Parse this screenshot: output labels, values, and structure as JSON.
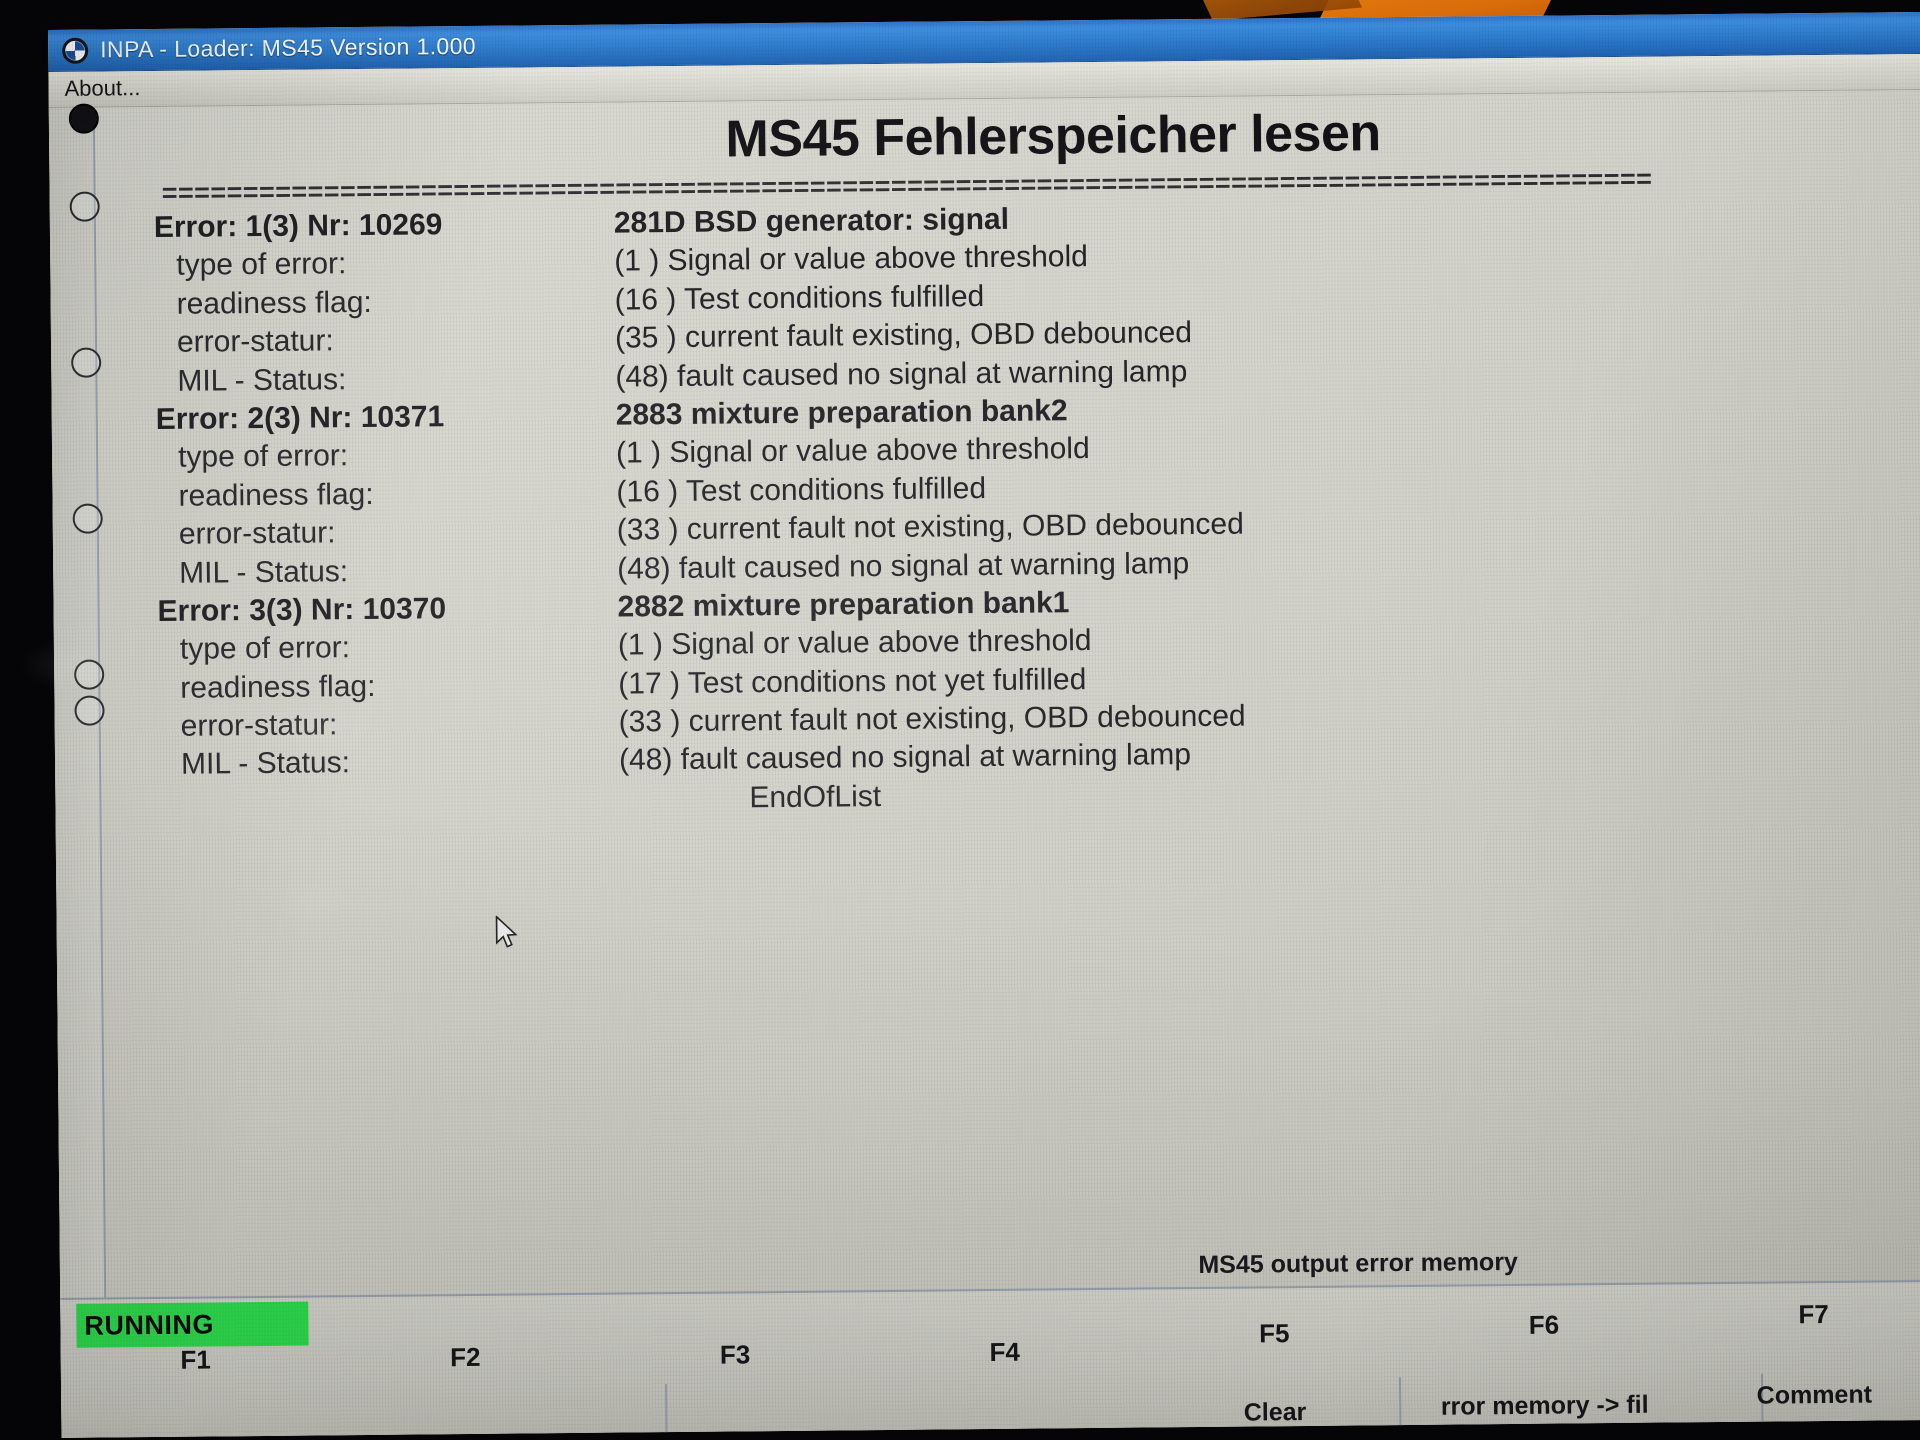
{
  "window": {
    "title": "INPA - Loader:  MS45 Version 1.000",
    "icon": "bmw-roundel-icon"
  },
  "menu": {
    "items": [
      {
        "label": "About..."
      }
    ]
  },
  "page": {
    "heading": "MS45 Fehlerspeicher lesen",
    "separator": "============================================================================================",
    "end_of_list": "EndOfList"
  },
  "labels": {
    "type_of_error": "type of error:",
    "readiness_flag": "readiness flag:",
    "error_statur": "error-statur:",
    "mil_status": "MIL - Status:"
  },
  "errors": [
    {
      "header_label": "Error: 1(3) Nr: 10269",
      "header_value": "281D BSD generator: signal",
      "type_of_error": "(1 ) Signal or value above threshold",
      "readiness_flag": "(16 ) Test conditions fulfilled",
      "error_statur": "(35 ) current fault existing, OBD debounced",
      "mil_status": "(48) fault caused no signal at warning lamp"
    },
    {
      "header_label": "Error: 2(3) Nr: 10371",
      "header_value": "2883 mixture preparation bank2",
      "type_of_error": "(1 ) Signal or value above threshold",
      "readiness_flag": "(16 ) Test conditions fulfilled",
      "error_statur": "(33 ) current fault not existing, OBD debounced",
      "mil_status": "(48) fault caused no signal at warning lamp"
    },
    {
      "header_label": "Error: 3(3) Nr: 10370",
      "header_value": "2882 mixture preparation bank1",
      "type_of_error": "(1 ) Signal or value above threshold",
      "readiness_flag": "(17 ) Test conditions not yet fulfilled",
      "error_statur": "(33 ) current fault not existing, OBD debounced",
      "mil_status": "(48) fault caused no signal at warning lamp"
    }
  ],
  "statusbar": {
    "run_state": "RUNNING",
    "status_text": "MS45 output error memory",
    "fkeys": [
      {
        "key": "F1",
        "caption": ""
      },
      {
        "key": "F2",
        "caption": ""
      },
      {
        "key": "F3",
        "caption": ""
      },
      {
        "key": "F4",
        "caption": ""
      },
      {
        "key": "F5",
        "caption": "Clear"
      },
      {
        "key": "F6",
        "caption": "rror memory -> fil"
      },
      {
        "key": "F7",
        "caption": "Comment"
      }
    ]
  },
  "colors": {
    "titlebar_blue": "#2d7ccd",
    "running_green": "#2fdf4f",
    "client_gray": "#d3d3cb",
    "text_black": "#1a1a1f"
  }
}
